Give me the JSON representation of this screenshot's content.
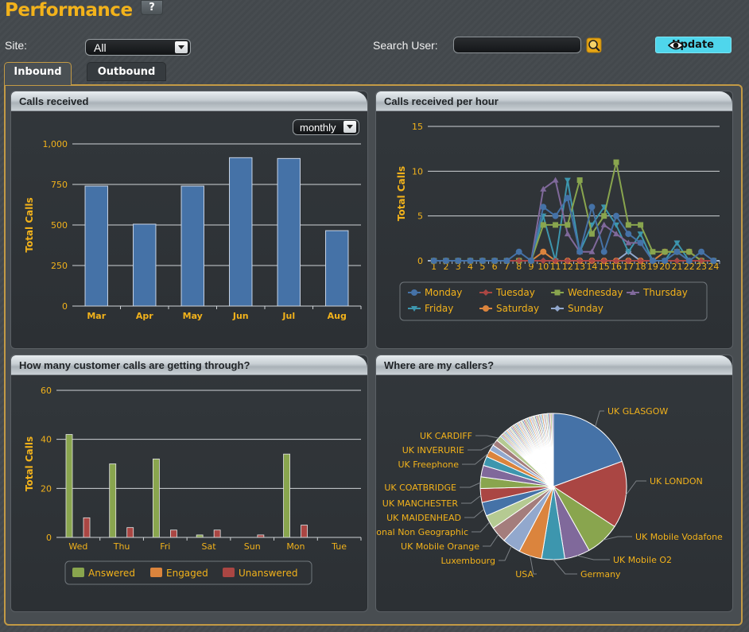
{
  "header": {
    "title": "Performance",
    "help_label": "?",
    "site_label": "Site:",
    "site_value": "All",
    "search_label": "Search User:",
    "search_value": "",
    "update_label": "Update"
  },
  "tabs": [
    {
      "label": "Inbound",
      "active": true
    },
    {
      "label": "Outbound",
      "active": false
    }
  ],
  "panels": {
    "calls_received": {
      "title": "Calls received",
      "period_value": "monthly"
    },
    "calls_per_hour": {
      "title": "Calls received per hour"
    },
    "getting_through": {
      "title": "How many customer calls are getting through?"
    },
    "callers_location": {
      "title": "Where are my callers?"
    }
  },
  "colors": {
    "accent": "#f2b21b",
    "update_button": "#4fd6ec",
    "frame_border": "#c39a45"
  },
  "chart_data": [
    {
      "id": "calls_received",
      "type": "bar",
      "title": "Calls received",
      "xlabel": "",
      "ylabel": "Total Calls",
      "categories": [
        "Mar",
        "Apr",
        "May",
        "Jun",
        "Jul",
        "Aug"
      ],
      "values": [
        740,
        505,
        740,
        915,
        910,
        465
      ],
      "ylim": [
        0,
        1000
      ],
      "yticks": [
        0,
        250,
        500,
        750,
        1000
      ],
      "ytick_labels": [
        "0",
        "250",
        "500",
        "750",
        "1,000"
      ],
      "color": "#4572a7",
      "grid": true
    },
    {
      "id": "calls_per_hour",
      "type": "line",
      "title": "Calls received per hour",
      "ylabel": "Total Calls",
      "x": [
        1,
        2,
        3,
        4,
        5,
        6,
        7,
        8,
        9,
        10,
        11,
        12,
        13,
        14,
        15,
        16,
        17,
        18,
        19,
        20,
        21,
        22,
        23,
        24
      ],
      "ylim": [
        0,
        15
      ],
      "yticks": [
        0,
        5,
        10,
        15
      ],
      "grid": true,
      "legend_position": "bottom",
      "series": [
        {
          "name": "Monday",
          "color": "#4572a7",
          "marker": "circle",
          "values": [
            0,
            0,
            0,
            0,
            0,
            0,
            0,
            1,
            0,
            6,
            5,
            7,
            1,
            6,
            1,
            5,
            3,
            2,
            0,
            0,
            1,
            0,
            1,
            0
          ]
        },
        {
          "name": "Tuesday",
          "color": "#aa4643",
          "marker": "diamond",
          "values": [
            0,
            0,
            0,
            0,
            0,
            0,
            0,
            0,
            0,
            0,
            0,
            0,
            0,
            0,
            0,
            0,
            0,
            0,
            0,
            0,
            0,
            0,
            0,
            0
          ]
        },
        {
          "name": "Wednesday",
          "color": "#89a54e",
          "marker": "square",
          "values": [
            0,
            0,
            0,
            0,
            0,
            0,
            0,
            0,
            0,
            4,
            4,
            4,
            9,
            3,
            5,
            11,
            4,
            4,
            1,
            1,
            1,
            1,
            0,
            0
          ]
        },
        {
          "name": "Thursday",
          "color": "#80699b",
          "marker": "triangle",
          "values": [
            0,
            0,
            0,
            0,
            0,
            0,
            0,
            0,
            0,
            8,
            9,
            3,
            1,
            1,
            4,
            3,
            2,
            2,
            0,
            0,
            1,
            0,
            0,
            0
          ]
        },
        {
          "name": "Friday",
          "color": "#3d96ae",
          "marker": "triangle-down",
          "values": [
            0,
            0,
            0,
            0,
            0,
            0,
            0,
            0,
            0,
            5,
            0,
            9,
            1,
            4,
            6,
            4,
            1,
            3,
            0,
            0,
            2,
            0,
            0,
            0
          ]
        },
        {
          "name": "Saturday",
          "color": "#db843d",
          "marker": "circle",
          "values": [
            0,
            0,
            0,
            0,
            0,
            0,
            0,
            0,
            0,
            1,
            0,
            0,
            0,
            0,
            0,
            0,
            0,
            0,
            0,
            1,
            1,
            1,
            0,
            0
          ]
        },
        {
          "name": "Sunday",
          "color": "#92a8cd",
          "marker": "diamond",
          "values": [
            0,
            0,
            0,
            0,
            0,
            0,
            0,
            0,
            0,
            0,
            0,
            0,
            0,
            0,
            0,
            0,
            1,
            0,
            0,
            0,
            0,
            0,
            0,
            0
          ]
        }
      ]
    },
    {
      "id": "getting_through",
      "type": "bar",
      "title": "How many customer calls are getting through?",
      "ylabel": "Total Calls",
      "categories": [
        "Wed",
        "Thu",
        "Fri",
        "Sat",
        "Sun",
        "Mon",
        "Tue"
      ],
      "ylim": [
        0,
        60
      ],
      "yticks": [
        0,
        20,
        40,
        60
      ],
      "grid": true,
      "legend_position": "bottom",
      "series": [
        {
          "name": "Answered",
          "color": "#89a54e",
          "values": [
            42,
            30,
            32,
            1,
            0,
            34,
            0
          ]
        },
        {
          "name": "Engaged",
          "color": "#db843d",
          "values": [
            0,
            0,
            0,
            0,
            0,
            0,
            0
          ]
        },
        {
          "name": "Unanswered",
          "color": "#aa4643",
          "values": [
            8,
            4,
            3,
            3,
            1,
            5,
            0
          ]
        }
      ]
    },
    {
      "id": "callers_location",
      "type": "pie",
      "title": "Where are my callers?",
      "labeled_slices": [
        {
          "label": "UK GLASGOW",
          "value": 19.0,
          "color": "#4572a7"
        },
        {
          "label": "UK LONDON",
          "value": 14.5,
          "color": "#aa4643"
        },
        {
          "label": "UK Mobile Vodafone",
          "value": 7.5,
          "color": "#89a54e"
        },
        {
          "label": "UK Mobile O2",
          "value": 5.5,
          "color": "#80699b"
        },
        {
          "label": "Germany",
          "value": 5.0,
          "color": "#3d96ae"
        },
        {
          "label": "USA",
          "value": 5.0,
          "color": "#db843d"
        },
        {
          "label": "Luxembourg",
          "value": 4.0,
          "color": "#92a8cd"
        },
        {
          "label": "UK Mobile Orange",
          "value": 3.5,
          "color": "#a47d7c"
        },
        {
          "label": "National Non Geographic",
          "value": 3.0,
          "color": "#b5ca92"
        },
        {
          "label": "UK MAIDENHEAD",
          "value": 3.0,
          "color": "#4572a7"
        },
        {
          "label": "UK MANCHESTER",
          "value": 3.0,
          "color": "#aa4643"
        },
        {
          "label": "UK COATBRIDGE",
          "value": 2.5,
          "color": "#89a54e"
        },
        {
          "label": "",
          "value": 2.5,
          "color": "#80699b"
        },
        {
          "label": "",
          "value": 2.0,
          "color": "#3d96ae"
        },
        {
          "label": "UK Freephone",
          "value": 1.5,
          "color": "#db843d"
        },
        {
          "label": "",
          "value": 1.3,
          "color": "#92a8cd"
        },
        {
          "label": "UK INVERURIE",
          "value": 1.3,
          "color": "#a47d7c"
        },
        {
          "label": "UK CARDIFF",
          "value": 1.2,
          "color": "#b5ca92"
        }
      ],
      "small_slices_count": 40,
      "small_slices_total": 12.6
    }
  ]
}
